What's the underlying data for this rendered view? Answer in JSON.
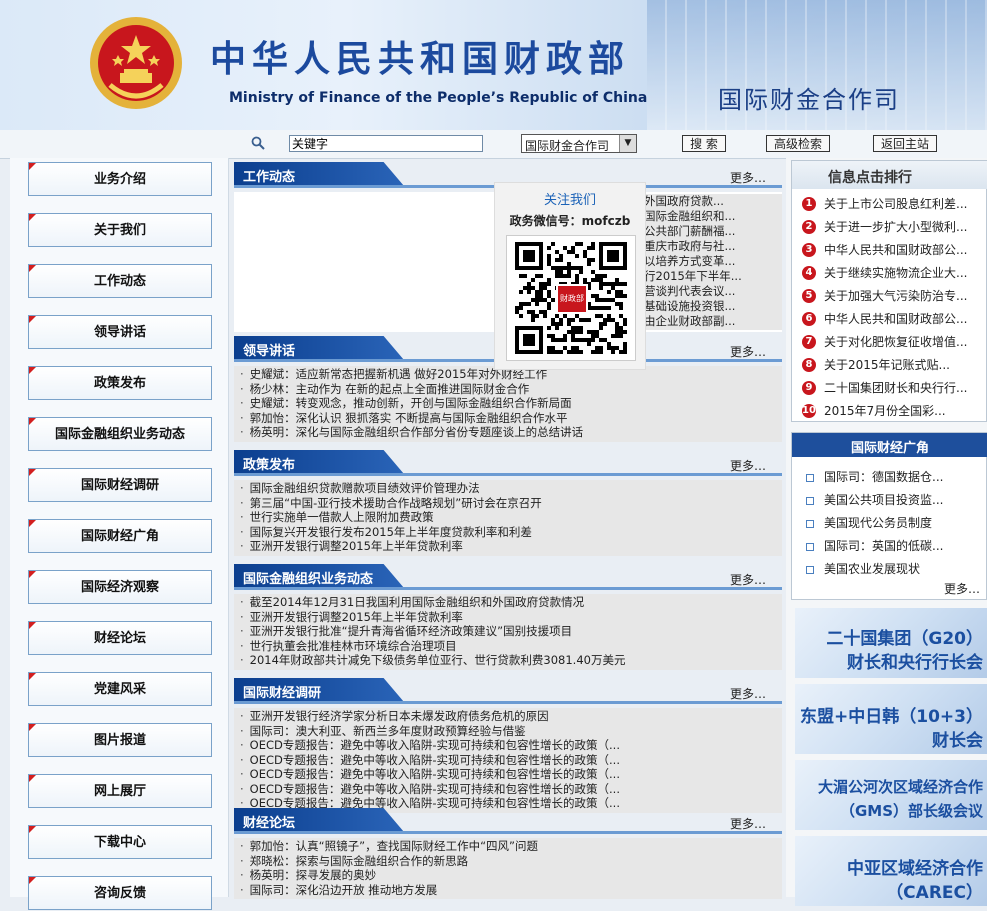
{
  "header": {
    "title_cn": "中华人民共和国财政部",
    "title_en": "Ministry of Finance of the People’s Republic of China",
    "section": "国际财金合作司"
  },
  "search": {
    "value": "关键字",
    "scope": "国际财金合作司",
    "search_label": "搜 索",
    "advanced_label": "高级检索",
    "home_label": "返回主站"
  },
  "nav": {
    "items": [
      "业务介绍",
      "关于我们",
      "工作动态",
      "领导讲话",
      "政策发布",
      "国际金融组织业务动态",
      "国际财经调研",
      "国际财经广角",
      "国际经济观察",
      "财经论坛",
      "党建风采",
      "图片报道",
      "网上展厅",
      "下载中心",
      "咨询反馈"
    ]
  },
  "wechat": {
    "title": "关注我们",
    "id": "政务微信号：mofczb",
    "qr_logo": "财政部"
  },
  "blocks": {
    "work": {
      "title": "工作动态",
      "more": "更多…",
      "items": [
        "外国政府贷款...",
        "国际金融组织和...",
        "公共部门薪酬福...",
        "重庆市政府与社...",
        "以培养方式变革...",
        "行2015年下半年...",
        "营谈判代表会议...",
        "基础设施投资银...",
        "由企业财政部副..."
      ]
    },
    "speech": {
      "title": "领导讲话",
      "more": "更多…",
      "items": [
        "史耀斌：适应新常态把握新机遇 做好2015年对外财经工作",
        "杨少林：主动作为 在新的起点上全面推进国际财金合作",
        "史耀斌：转变观念，推动创新，开创与国际金融组织合作新局面",
        "郭加怡：深化认识 狠抓落实 不断提高与国际金融组织合作水平",
        "杨英明：深化与国际金融组织合作部分省份专题座谈上的总结讲话"
      ]
    },
    "policy": {
      "title": "政策发布",
      "more": "更多…",
      "items": [
        "国际金融组织贷款赠款项目绩效评价管理办法",
        "第三届“中国-亚行技术援助合作战略规划”研讨会在京召开",
        "世行实施单一借款人上限附加费政策",
        "国际复兴开发银行发布2015年上半年度贷款利率和利差",
        "亚洲开发银行调整2015年上半年贷款利率"
      ]
    },
    "ifi": {
      "title": "国际金融组织业务动态",
      "more": "更多…",
      "items": [
        "截至2014年12月31日我国利用国际金融组织和外国政府贷款情况",
        "亚洲开发银行调整2015年上半年贷款利率",
        "亚洲开发银行批准“提升青海省循环经济政策建议”国别技援项目",
        "世行执董会批准桂林市环境综合治理项目",
        "2014年财政部共计减免下级债务单位亚行、世行贷款利费3081.40万美元"
      ]
    },
    "research": {
      "title": "国际财经调研",
      "more": "更多…",
      "items": [
        "亚洲开发银行经济学家分析日本未爆发政府债务危机的原因",
        "国际司：澳大利亚、新西兰多年度财政预算经验与借鉴",
        "OECD专题报告：避免中等收入陷阱-实现可持续和包容性增长的政策（...",
        "OECD专题报告：避免中等收入陷阱-实现可持续和包容性增长的政策（...",
        "OECD专题报告：避免中等收入陷阱-实现可持续和包容性增长的政策（...",
        "OECD专题报告：避免中等收入陷阱-实现可持续和包容性增长的政策（...",
        "OECD专题报告：避免中等收入陷阱-实现可持续和包容性增长的政策（..."
      ]
    },
    "forum": {
      "title": "财经论坛",
      "more": "更多…",
      "items": [
        "郭加怡：认真“照镜子”，查找国际财经工作中“四风”问题",
        "郑晓松：探索与国际金融组织合作的新思路",
        "杨英明：探寻发展的奥妙",
        "国际司：深化沿边开放 推动地方发展"
      ]
    }
  },
  "ranking": {
    "title": "信息点击排行",
    "items": [
      {
        "n": "1",
        "t": "关于上市公司股息红利差..."
      },
      {
        "n": "2",
        "t": "关于进一步扩大小型微利..."
      },
      {
        "n": "3",
        "t": "中华人民共和国财政部公..."
      },
      {
        "n": "4",
        "t": "关于继续实施物流企业大..."
      },
      {
        "n": "5",
        "t": "关于加强大气污染防治专..."
      },
      {
        "n": "6",
        "t": "中华人民共和国财政部公..."
      },
      {
        "n": "7",
        "t": "关于对化肥恢复征收增值..."
      },
      {
        "n": "8",
        "t": "关于2015年记账式贴..."
      },
      {
        "n": "9",
        "t": "二十国集团财长和央行行..."
      },
      {
        "n": "10",
        "t": "2015年7月份全国彩..."
      }
    ]
  },
  "intl": {
    "title": "国际财经广角",
    "more": "更多…",
    "items": [
      "国际司：德国数据仓...",
      "美国公共项目投资监...",
      "美国现代公务员制度",
      "国际司：英国的低碳...",
      "美国农业发展现状"
    ]
  },
  "banners": [
    {
      "l1": "二十国集团（G20）",
      "l2": "财长和央行行长会"
    },
    {
      "l1": "东盟+中日韩（10+3）",
      "l2": "财长会"
    },
    {
      "l1": "大湄公河次区域经济合作",
      "l2": "（GMS）部长级会议"
    },
    {
      "l1": "中亚区域经济合作",
      "l2": "（CAREC）"
    }
  ]
}
